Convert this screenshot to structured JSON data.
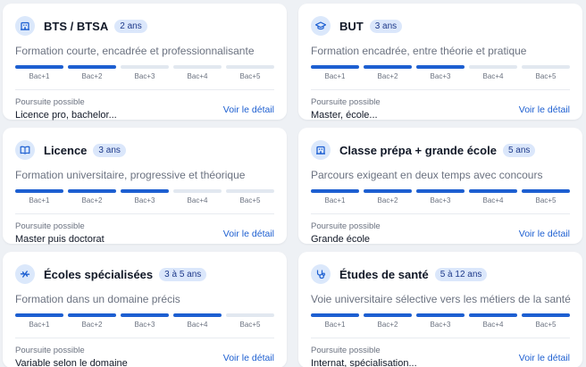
{
  "common": {
    "levels": [
      "Bac+1",
      "Bac+2",
      "Bac+3",
      "Bac+4",
      "Bac+5"
    ],
    "pursuit_label": "Poursuite possible",
    "detail_label": "Voir le détail",
    "accent_color": "#1d5fd1"
  },
  "cards": [
    {
      "icon": "building-icon",
      "title": "BTS / BTSA",
      "duration": "2 ans",
      "description": "Formation courte, encadrée et professionnalisante",
      "filled": 2,
      "pursuit": "Licence pro, bachelor..."
    },
    {
      "icon": "graduation-cap-icon",
      "title": "BUT",
      "duration": "3 ans",
      "description": "Formation encadrée, entre théorie et pratique",
      "filled": 3,
      "pursuit": "Master, école..."
    },
    {
      "icon": "book-icon",
      "title": "Licence",
      "duration": "3 ans",
      "description": "Formation universitaire, progressive et théorique",
      "filled": 3,
      "pursuit": "Master puis doctorat"
    },
    {
      "icon": "building-icon",
      "title": "Classe prépa + grande école",
      "duration": "5 ans",
      "description": "Parcours exigeant en deux temps avec concours",
      "filled": 5,
      "pursuit": "Grande école"
    },
    {
      "icon": "bolt-icon",
      "title": "Écoles spécialisées",
      "duration": "3 à 5 ans",
      "description": "Formation dans un domaine précis",
      "filled": 4,
      "pursuit": "Variable selon le domaine"
    },
    {
      "icon": "stethoscope-icon",
      "title": "Études de santé",
      "duration": "5 à 12 ans",
      "description": "Voie universitaire sélective vers les métiers de la santé",
      "filled": 5,
      "pursuit": "Internat, spécialisation..."
    }
  ]
}
